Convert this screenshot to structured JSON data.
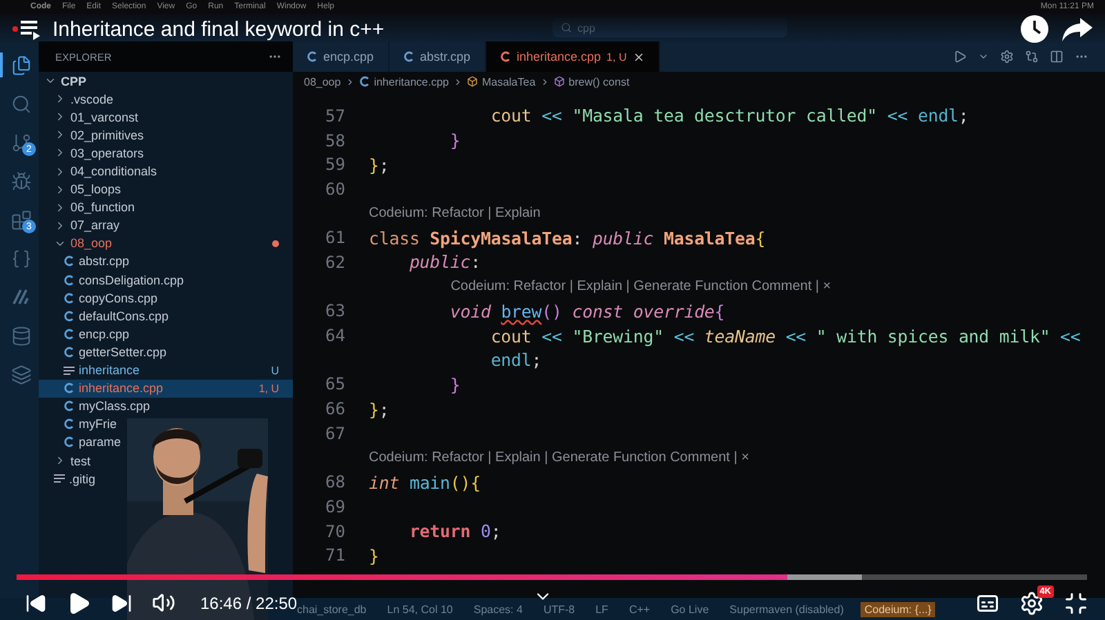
{
  "menubar": {
    "items": [
      "Code",
      "File",
      "Edit",
      "Selection",
      "View",
      "Go",
      "Run",
      "Terminal",
      "Window",
      "Help"
    ],
    "clock": "Mon 11:21 PM"
  },
  "video": {
    "title": "Inheritance and final keyword in c++",
    "time": "16:46 / 22:50",
    "quality_badge": "4K",
    "played": {
      "level": 0.72
    },
    "buffered": {
      "level": 0.79
    }
  },
  "titlebar": {
    "search": "cpp"
  },
  "activity_bar": [
    {
      "kind": "files",
      "selected": true
    },
    {
      "kind": "search",
      "selected": false
    },
    {
      "kind": "git",
      "selected": false,
      "badge": "2"
    },
    {
      "kind": "run",
      "selected": false
    },
    {
      "kind": "extensions",
      "selected": false,
      "badge": "3"
    },
    {
      "kind": "braces",
      "selected": false
    },
    {
      "kind": "codeium",
      "selected": false
    },
    {
      "kind": "database",
      "selected": false
    },
    {
      "kind": "layers",
      "selected": false
    }
  ],
  "explorer": {
    "title": "EXPLORER",
    "tree": [
      {
        "label": "CPP",
        "kind": "root",
        "expanded": true,
        "selected": false,
        "color": "#c5cbd3",
        "children": [
          {
            "label": ".vscode",
            "kind": "folder",
            "expanded": false,
            "selected": false,
            "color": "#c5cbd3"
          },
          {
            "label": "01_varconst",
            "kind": "folder",
            "expanded": false,
            "selected": false,
            "color": "#c5cbd3"
          },
          {
            "label": "02_primitives",
            "kind": "folder",
            "expanded": false,
            "selected": false,
            "color": "#c5cbd3"
          },
          {
            "label": "03_operators",
            "kind": "folder",
            "expanded": false,
            "selected": false,
            "color": "#c5cbd3"
          },
          {
            "label": "04_conditionals",
            "kind": "folder",
            "expanded": false,
            "selected": false,
            "color": "#c5cbd3"
          },
          {
            "label": "05_loops",
            "kind": "folder",
            "expanded": false,
            "selected": false,
            "color": "#c5cbd3"
          },
          {
            "label": "06_function",
            "kind": "folder",
            "expanded": false,
            "selected": false,
            "color": "#c5cbd3"
          },
          {
            "label": "07_array",
            "kind": "folder",
            "expanded": false,
            "selected": false,
            "color": "#c5cbd3"
          },
          {
            "label": "08_oop",
            "kind": "folder",
            "expanded": true,
            "selected": false,
            "color": "#e8705a",
            "dot": true,
            "children": [
              {
                "label": "abstr.cpp",
                "kind": "cpp",
                "selected": false,
                "color": "#c5cbd3"
              },
              {
                "label": "consDeligation.cpp",
                "kind": "cpp",
                "selected": false,
                "color": "#c5cbd3"
              },
              {
                "label": "copyCons.cpp",
                "kind": "cpp",
                "selected": false,
                "color": "#c5cbd3"
              },
              {
                "label": "defaultCons.cpp",
                "kind": "cpp",
                "selected": false,
                "color": "#c5cbd3"
              },
              {
                "label": "encp.cpp",
                "kind": "cpp",
                "selected": false,
                "color": "#c5cbd3"
              },
              {
                "label": "getterSetter.cpp",
                "kind": "cpp",
                "selected": false,
                "color": "#c5cbd3"
              },
              {
                "label": "inheritance",
                "kind": "binary",
                "selected": false,
                "color": "#6fb8e8",
                "badge": "U"
              },
              {
                "label": "inheritance.cpp",
                "kind": "cpp",
                "selected": true,
                "color": "#e8705a",
                "badge": "1, U"
              },
              {
                "label": "myClass.cpp",
                "kind": "cpp",
                "selected": false,
                "color": "#c5cbd3"
              },
              {
                "label": "myFrie",
                "kind": "cpp",
                "selected": false,
                "color": "#c5cbd3"
              },
              {
                "label": "parame",
                "kind": "cpp",
                "selected": false,
                "color": "#c5cbd3"
              }
            ]
          },
          {
            "label": "test",
            "kind": "folder",
            "expanded": false,
            "selected": false,
            "color": "#c5cbd3"
          },
          {
            "label": ".gitig",
            "kind": "gitignore",
            "selected": false,
            "color": "#c5cbd3"
          }
        ]
      }
    ]
  },
  "tabs": [
    {
      "label": "encp.cpp",
      "selected": false
    },
    {
      "label": "abstr.cpp",
      "selected": false
    },
    {
      "label": "inheritance.cpp",
      "selected": true,
      "badge": "1, U"
    }
  ],
  "breadcrumbs": [
    {
      "label": "08_oop",
      "kind": "folder"
    },
    {
      "label": "inheritance.cpp",
      "kind": "cpp"
    },
    {
      "label": "MasalaTea",
      "kind": "class"
    },
    {
      "label": "brew() const",
      "kind": "method"
    }
  ],
  "code": [
    {
      "kind": "code",
      "number": "57",
      "tokens": [
        {
          "text": "            cout",
          "kind": "call"
        },
        {
          "text": " <<",
          "kind": "op"
        },
        {
          "text": " \"Masala tea desctrutor called\"",
          "kind": "str"
        },
        {
          "text": " <<",
          "kind": "op"
        },
        {
          "text": " endl",
          "kind": "name"
        },
        {
          "text": ";",
          "kind": "plain"
        }
      ]
    },
    {
      "kind": "code",
      "number": "58",
      "tokens": [
        {
          "text": "        }",
          "kind": "brace2"
        }
      ]
    },
    {
      "kind": "code",
      "number": "59",
      "tokens": [
        {
          "text": "}",
          "kind": "brace1"
        },
        {
          "text": ";",
          "kind": "plain"
        }
      ]
    },
    {
      "kind": "code",
      "number": "60"
    },
    {
      "kind": "lens",
      "text": "Codeium: Refactor | Explain"
    },
    {
      "kind": "code",
      "number": "61",
      "tokens": [
        {
          "text": "class",
          "kind": "kw"
        },
        {
          "text": " SpicyMasalaTea",
          "kind": "type"
        },
        {
          "text": ":",
          "kind": "plain"
        },
        {
          "text": " public",
          "kind": "mod"
        },
        {
          "text": " MasalaTea",
          "kind": "type"
        },
        {
          "text": "{",
          "kind": "brace1"
        }
      ]
    },
    {
      "kind": "code",
      "number": "62",
      "tokens": [
        {
          "text": "    public",
          "kind": "mod"
        },
        {
          "text": ":",
          "kind": "plain"
        }
      ]
    },
    {
      "kind": "lens",
      "text": "Codeium: Refactor | Explain | Generate Function Comment | ×"
    },
    {
      "kind": "code",
      "number": "63",
      "tokens": [
        {
          "text": "        void ",
          "kind": "mod"
        },
        {
          "text": "brew",
          "kind": "fn",
          "squiggle": true
        },
        {
          "text": "()",
          "kind": "brace2"
        },
        {
          "text": " const",
          "kind": "mod"
        },
        {
          "text": " override",
          "kind": "mod"
        },
        {
          "text": "{",
          "kind": "brace2"
        }
      ]
    },
    {
      "kind": "code",
      "number": "64",
      "tokens": [
        {
          "text": "            cout",
          "kind": "call"
        },
        {
          "text": " <<",
          "kind": "op"
        },
        {
          "text": " \"Brewing\"",
          "kind": "str"
        },
        {
          "text": " <<",
          "kind": "op"
        },
        {
          "text": " teaName",
          "kind": "var"
        },
        {
          "text": " <<",
          "kind": "op"
        },
        {
          "text": " \" with spices and milk\"",
          "kind": "str"
        },
        {
          "text": " <<",
          "kind": "op"
        }
      ]
    },
    {
      "kind": "wrap",
      "tokens": [
        {
          "text": "            endl",
          "kind": "name"
        },
        {
          "text": ";",
          "kind": "plain"
        }
      ]
    },
    {
      "kind": "code",
      "number": "65",
      "tokens": [
        {
          "text": "        }",
          "kind": "brace2"
        }
      ]
    },
    {
      "kind": "code",
      "number": "66",
      "tokens": [
        {
          "text": "}",
          "kind": "brace1"
        },
        {
          "text": ";",
          "kind": "plain"
        }
      ]
    },
    {
      "kind": "code",
      "number": "67"
    },
    {
      "kind": "lens",
      "text": "Codeium: Refactor | Explain | Generate Function Comment | ×"
    },
    {
      "kind": "code",
      "number": "68",
      "tokens": [
        {
          "text": "int",
          "kind": "typekw"
        },
        {
          "text": " main",
          "kind": "fn2"
        },
        {
          "text": "(){",
          "kind": "brace1"
        }
      ]
    },
    {
      "kind": "code",
      "number": "69"
    },
    {
      "kind": "code",
      "number": "70",
      "tokens": [
        {
          "text": "    return",
          "kind": "ret"
        },
        {
          "text": " 0",
          "kind": "num"
        },
        {
          "text": ";",
          "kind": "plain"
        }
      ]
    },
    {
      "kind": "code",
      "number": "71",
      "tokens": [
        {
          "text": "}",
          "kind": "brace1"
        }
      ]
    }
  ],
  "status_bar": [
    {
      "text": "chai_store_db",
      "kind": "plain"
    },
    {
      "text": "Ln 54, Col 10",
      "kind": "plain"
    },
    {
      "text": "Spaces: 4",
      "kind": "plain"
    },
    {
      "text": "UTF-8",
      "kind": "plain"
    },
    {
      "text": "LF",
      "kind": "plain"
    },
    {
      "text": "C++",
      "kind": "plain"
    },
    {
      "text": "Go Live",
      "kind": "plain"
    },
    {
      "text": "Supermaven (disabled)",
      "kind": "plain"
    },
    {
      "text": "Codeium: {...}",
      "kind": "highlight"
    }
  ]
}
